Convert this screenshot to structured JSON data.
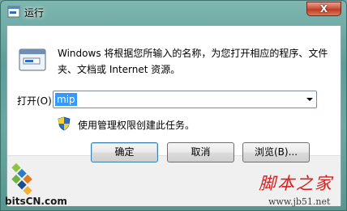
{
  "window": {
    "title": "运行",
    "close_label": "X"
  },
  "dialog": {
    "description": "Windows 将根据您所输入的名称，为您打开相应的程序、文件夹、文档或 Internet 资源。",
    "open_label": "打开(O):",
    "input_value": "mip",
    "admin_note": "使用管理权限创建此任务。"
  },
  "buttons": {
    "ok": "确定",
    "cancel": "取消",
    "browse": "浏览(B)..."
  },
  "watermarks": {
    "left_text": "bitsCN.com",
    "right_big": "脚本之家",
    "right_url": "www.jb51.net"
  },
  "colors": {
    "selection": "#3399ff",
    "close_red": "#c03c22",
    "watermark_red": "#d81e1e"
  },
  "icons": {
    "title": "run-icon",
    "app": "run-app-icon",
    "shield": "uac-shield-icon",
    "dropdown": "chevron-down-icon"
  }
}
